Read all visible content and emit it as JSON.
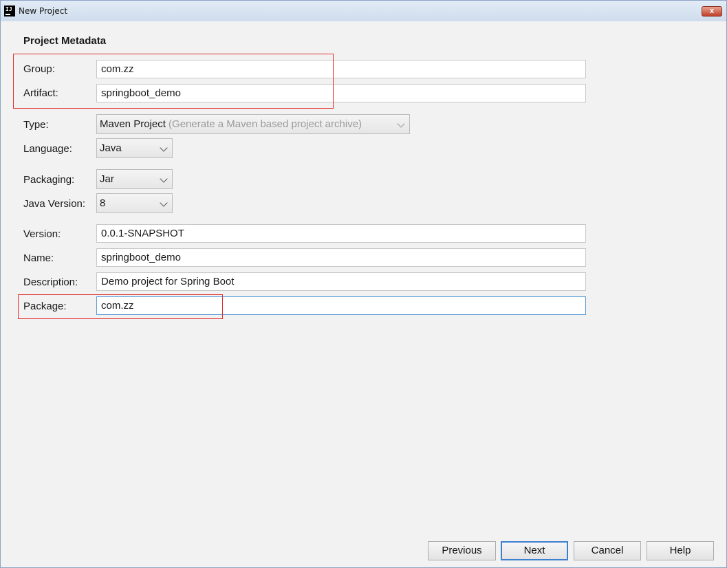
{
  "window": {
    "title": "New Project",
    "close_label": "x"
  },
  "section_title": "Project Metadata",
  "fields": {
    "group": {
      "label": "Group:",
      "value": "com.zz"
    },
    "artifact": {
      "label": "Artifact:",
      "value": "springboot_demo"
    },
    "type": {
      "label": "Type:",
      "value": "Maven Project",
      "hint": "(Generate a Maven based project archive)"
    },
    "language": {
      "label": "Language:",
      "value": "Java"
    },
    "packaging": {
      "label": "Packaging:",
      "value": "Jar"
    },
    "java_version": {
      "label": "Java Version:",
      "value": "8"
    },
    "version": {
      "label": "Version:",
      "value": "0.0.1-SNAPSHOT"
    },
    "name": {
      "label": "Name:",
      "value": "springboot_demo"
    },
    "description": {
      "label": "Description:",
      "value": "Demo project for Spring Boot"
    },
    "package": {
      "label": "Package:",
      "value": "com.zz"
    }
  },
  "buttons": {
    "previous": "Previous",
    "next": "Next",
    "cancel": "Cancel",
    "help": "Help"
  },
  "colors": {
    "annotation_red": "#e23030",
    "focus_blue": "#5b9bd5",
    "default_button_blue": "#3c7fd1"
  },
  "icons": {
    "app": "intellij-app-icon",
    "close": "close-icon",
    "dropdown": "chevron-down-icon"
  }
}
